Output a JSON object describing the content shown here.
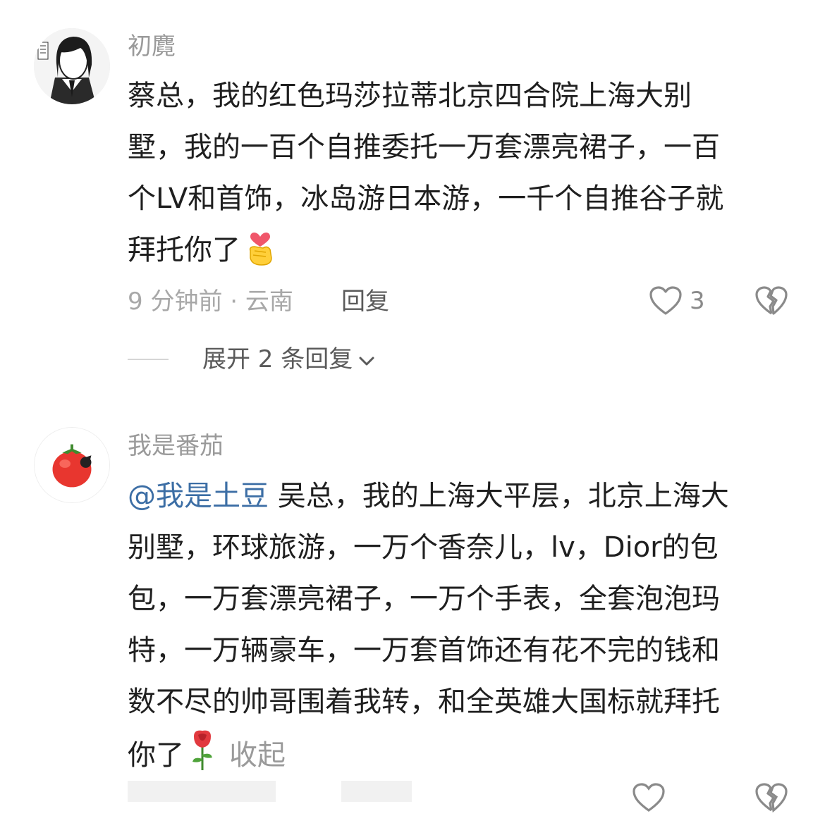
{
  "comments": [
    {
      "username": "初麑",
      "lines": [
        "蔡总，我的红色玛莎拉蒂北京四合院上海大别",
        "墅，我的一百个自推委托一万套漂亮裙子，一百",
        "个LV和首饰，冰岛游日本游，一千个自推谷子就",
        "拜托你了"
      ],
      "emoji": "finger-heart-icon",
      "time_location": "9 分钟前 · 云南",
      "reply_label": "回复",
      "like_count": "3",
      "expand_label": "展开 2 条回复"
    },
    {
      "username": "我是番茄",
      "mention": "@我是土豆",
      "lines": [
        " 吴总，我的上海大平层，北京上海大",
        "别墅，环球旅游，一万个香奈儿，lv，Dior的包",
        "包，一万套漂亮裙子，一万个手表，全套泡泡玛",
        "特，一万辆豪车，一万套首饰还有花不完的钱和",
        "数不尽的帅哥围着我转，和全英雄大国标就拜托",
        "你了"
      ],
      "emoji": "rose-icon",
      "collapse_label": "收起"
    }
  ]
}
